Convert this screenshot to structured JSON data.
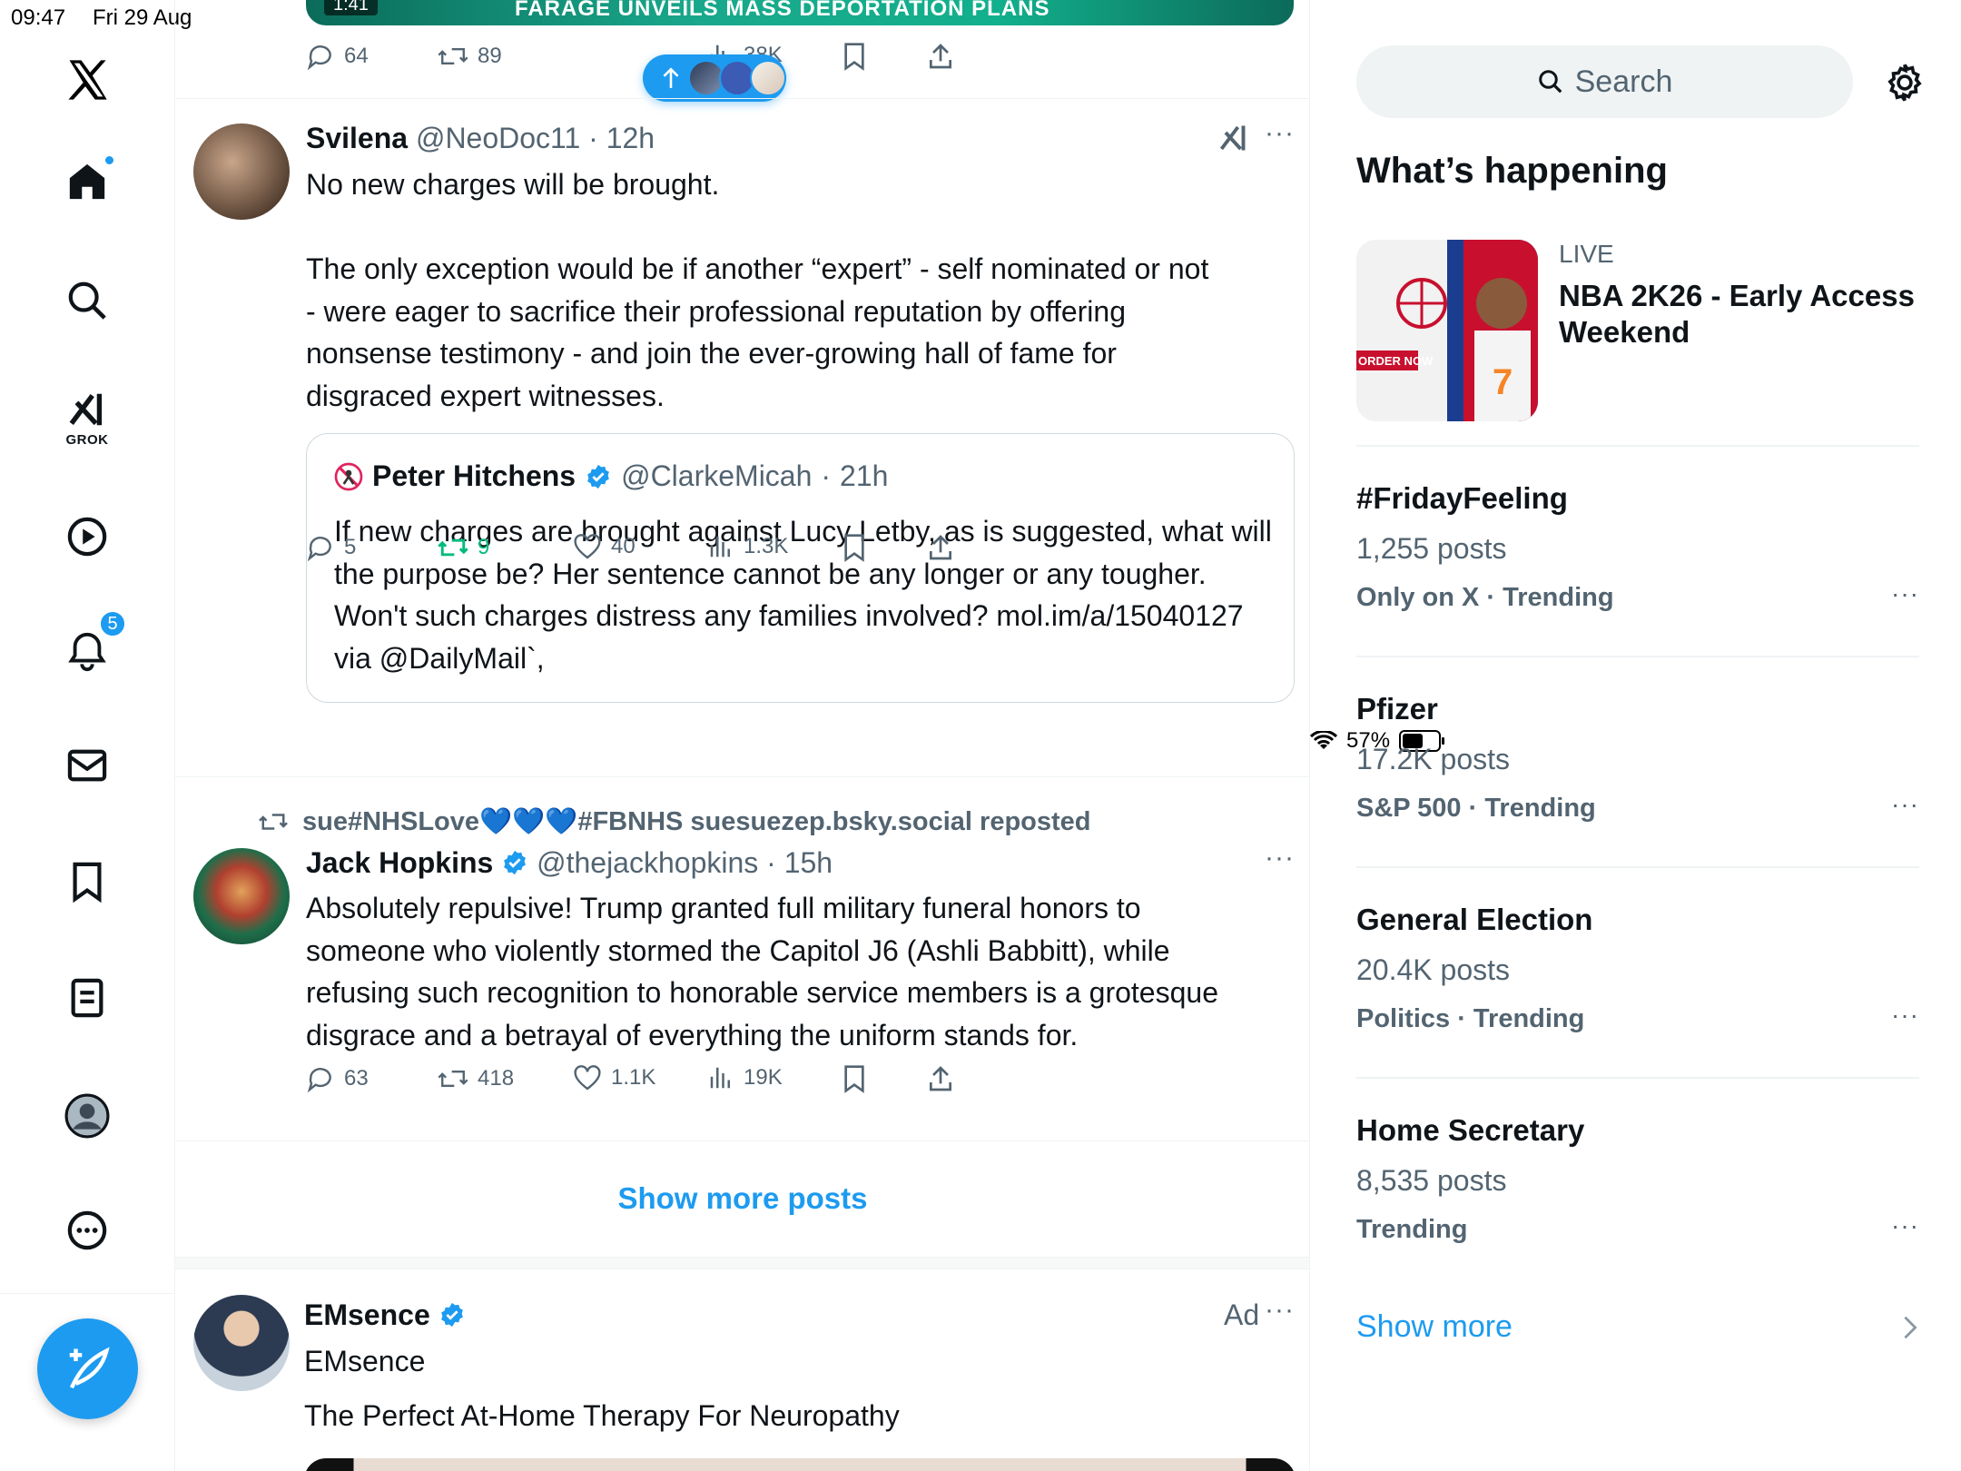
{
  "status_bar": {
    "time": "09:47",
    "date": "Fri 29 Aug",
    "battery": "57%"
  },
  "nav": {
    "grok_label": "GROK",
    "notification_count": "5",
    "items": [
      "x-logo",
      "home-icon",
      "search-icon",
      "grok-icon",
      "video-icon",
      "bell-icon",
      "mail-icon",
      "bookmark-icon",
      "lists-icon",
      "profile-icon",
      "more-icon"
    ]
  },
  "top_post": {
    "media_text": "FARAGE UNVEILS MASS DEPORTATION PLANS",
    "media_duration": "1:41",
    "replies": "64",
    "reposts": "89",
    "views": "38K"
  },
  "post1": {
    "name": "Svilena",
    "handle": "@NeoDoc11",
    "time": "12h",
    "text_line1": "No new charges will be brought.",
    "text_para2": "The only exception would be if another “expert” - self nominated or not - were eager to sacrifice their professional reputation by offering nonsense testimony - and join the ever-growing hall of fame for disgraced expert witnesses.",
    "quote": {
      "name": "Peter Hitchens",
      "handle": "@ClarkeMicah",
      "time": "21h",
      "text": "If new charges are brought against Lucy Letby, as is suggested, what will the purpose be? Her sentence cannot be any longer or any tougher. Won't such charges distress any families involved? mol.im/a/15040127 via @DailyMail`,"
    },
    "replies": "5",
    "reposts": "9",
    "likes": "40",
    "views": "1.3K"
  },
  "post2": {
    "repost_by": "sue#NHSLove💙💙💙#FBNHS suesuezep.bsky.social reposted",
    "name": "Jack Hopkins",
    "handle": "@thejackhopkins",
    "time": "15h",
    "text": "Absolutely repulsive! Trump granted full military funeral honors to someone who violently stormed the Capitol J6 (Ashli Babbitt), while refusing such recognition to honorable service members is a grotesque disgrace and a betrayal of everything the uniform stands for.",
    "replies": "63",
    "reposts": "418",
    "likes": "1.1K",
    "views": "19K"
  },
  "show_more_posts": "Show more posts",
  "ad_post": {
    "name": "EMsence",
    "subline": "EMsence",
    "ad_label": "Ad",
    "text": "The Perfect At-Home Therapy For Neuropathy"
  },
  "sidebar": {
    "search_placeholder": "Search",
    "title": "What’s happening",
    "live": {
      "label": "LIVE",
      "title": "NBA 2K26 - Early Access Weekend",
      "image_text": "ORDER NOW"
    },
    "trends": [
      {
        "name": "#FridayFeeling",
        "count": "1,255 posts",
        "context": "Only on X · Trending"
      },
      {
        "name": "Pfizer",
        "count": "17.2K posts",
        "context": "S&P 500 · Trending"
      },
      {
        "name": "General Election",
        "count": "20.4K posts",
        "context": "Politics · Trending"
      },
      {
        "name": "Home Secretary",
        "count": "8,535 posts",
        "context": "Trending"
      }
    ],
    "show_more": "Show more"
  },
  "colors": {
    "accent": "#1d9bf0",
    "text": "#0f1419",
    "muted": "#536471",
    "repost_active": "#00ba7c"
  }
}
